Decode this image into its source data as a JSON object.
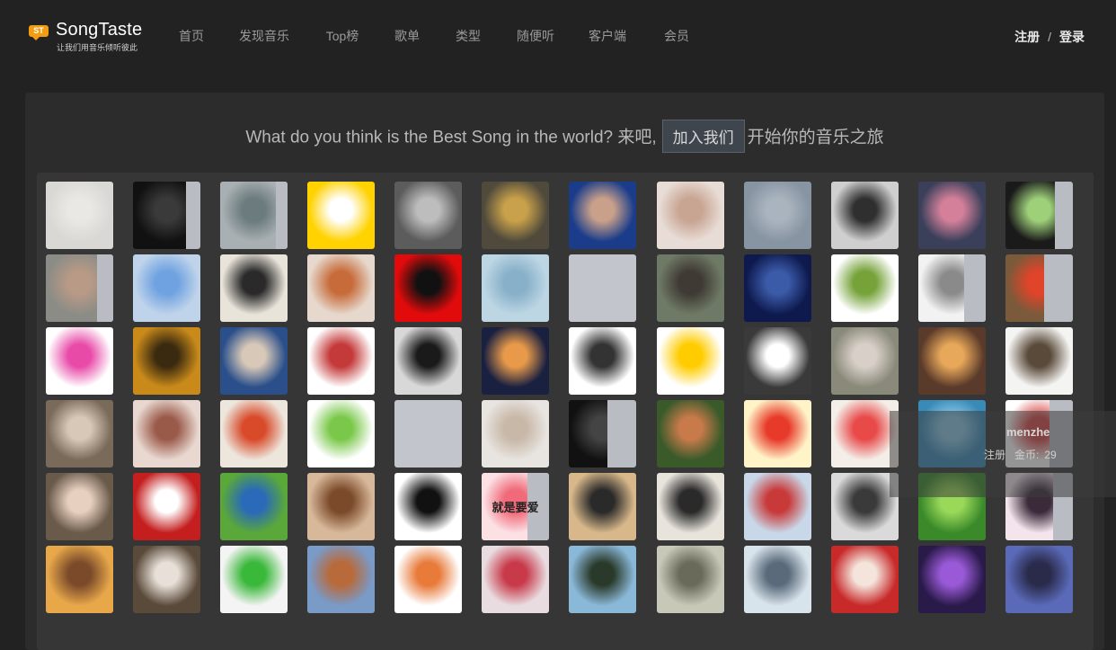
{
  "logo": {
    "badge": "ST",
    "name": "SongTaste",
    "slogan": "让我们用音乐倾听彼此"
  },
  "nav": [
    {
      "label": "首页",
      "active": true
    },
    {
      "label": "发现音乐",
      "active": false
    },
    {
      "label": "Top榜",
      "active": false
    },
    {
      "label": "歌单",
      "active": false
    },
    {
      "label": "类型",
      "active": false
    },
    {
      "label": "随便听",
      "active": false
    },
    {
      "label": "客户端",
      "active": false
    },
    {
      "label": "会员",
      "active": false
    }
  ],
  "auth": {
    "register": "注册",
    "separator": "/",
    "login": "登录"
  },
  "hero": {
    "text_before": "What do you think is the Best Song in the world? 来吧,",
    "join_button": "加入我们",
    "text_after": "开始你的音乐之旅"
  },
  "hover_card": {
    "name": "menzhe",
    "meta_a": "注册",
    "meta_b": "金币:",
    "meta_c": "29"
  },
  "avatars": [
    [
      {
        "c": "#d9d8d4",
        "c2": "#e9e8e4"
      },
      {
        "c": "#111111",
        "c2": "#3a3a3a",
        "strip": 16
      },
      {
        "c": "#a9b0b3",
        "c2": "#6b7b7e",
        "strip": 13
      },
      {
        "c": "#ffd200",
        "c2": "#ffffff"
      },
      {
        "c": "#5c5c5c",
        "c2": "#bdbdbd"
      },
      {
        "c": "#4f4a3c",
        "c2": "#c9a14a"
      },
      {
        "c": "#1a3c8a",
        "c2": "#c9a08a"
      },
      {
        "c": "#e8ddd6",
        "c2": "#c8a492"
      },
      {
        "c": "#8794a2",
        "c2": "#aab4bf"
      },
      {
        "c": "#cfcfcf",
        "c2": "#2f2f2f"
      },
      {
        "c": "#3a3f5a",
        "c2": "#d4809a"
      },
      {
        "c": "#1a1a1a",
        "c2": "#9ed07a",
        "strip": 20
      }
    ],
    [
      {
        "c": "#8c8c86",
        "c2": "#b89a86",
        "strip": 18
      },
      {
        "c": "#bfd3ea",
        "c2": "#6ea2e0"
      },
      {
        "c": "#e9e4da",
        "c2": "#2a2a2a"
      },
      {
        "c": "#e6d8cc",
        "c2": "#c76b3a"
      },
      {
        "c": "#e10b0b",
        "c2": "#111111"
      },
      {
        "c": "#bcd6e4",
        "c2": "#88b0c8"
      },
      {
        "c": "#c2c5cc",
        "c2": "#c2c5cc"
      },
      {
        "c": "#6f7a66",
        "c2": "#3f3a34"
      },
      {
        "c": "#0e1a4e",
        "c2": "#3b5aa8"
      },
      {
        "c": "#ffffff",
        "c2": "#76a23a"
      },
      {
        "c": "#f2f2f2",
        "c2": "#8a8a8a",
        "strip": 24
      },
      {
        "c": "#7a5a3a",
        "c2": "#e0442a",
        "strip": 32
      }
    ],
    [
      {
        "c": "#ffffff",
        "c2": "#e84aa8"
      },
      {
        "c": "#c98a1a",
        "c2": "#3a2a10"
      },
      {
        "c": "#2a4f8a",
        "c2": "#d8c8b8"
      },
      {
        "c": "#ffffff",
        "c2": "#c43a3a"
      },
      {
        "c": "#d8d8d8",
        "c2": "#1a1a1a"
      },
      {
        "c": "#1a2040",
        "c2": "#e89a4a"
      },
      {
        "c": "#ffffff",
        "c2": "#333333"
      },
      {
        "c": "#ffffff",
        "c2": "#ffcc00"
      },
      {
        "c": "#3a3a3a",
        "c2": "#ffffff"
      },
      {
        "c": "#8a8a7a",
        "c2": "#d8d0c8"
      },
      {
        "c": "#5a3a2a",
        "c2": "#e8a85a"
      },
      {
        "c": "#f4f4f2",
        "c2": "#5a4a3a"
      }
    ],
    [
      {
        "c": "#7a6a5a",
        "c2": "#d8c8b8"
      },
      {
        "c": "#e8d8d0",
        "c2": "#9a5a4a"
      },
      {
        "c": "#ede6dc",
        "c2": "#d84a2a"
      },
      {
        "c": "#ffffff",
        "c2": "#7ac84a"
      },
      {
        "c": "#c2c5cc",
        "c2": "#c2c5cc"
      },
      {
        "c": "#e8e4e0",
        "c2": "#c8b8a8"
      },
      {
        "c": "#111111",
        "c2": "#444444",
        "strip": 32
      },
      {
        "c": "#3a5a2a",
        "c2": "#c87a4a"
      },
      {
        "c": "#fff4c8",
        "c2": "#e83a2a"
      },
      {
        "c": "#f4eee8",
        "c2": "#e84a4a"
      },
      {
        "c": "#3a8ab8",
        "c2": "#8ac8e8"
      },
      {
        "c": "#ffffff",
        "c2": "#d84a4a",
        "strip": 26
      }
    ],
    [
      {
        "c": "#6a5a4a",
        "c2": "#e8d0c0"
      },
      {
        "c": "#c41e1e",
        "c2": "#ffffff"
      },
      {
        "c": "#5aa83a",
        "c2": "#2a6ab8"
      },
      {
        "c": "#d8b89a",
        "c2": "#7a4a2a"
      },
      {
        "c": "#ffffff",
        "c2": "#111111"
      },
      {
        "c": "#fce0e4",
        "c2": "#f06a7a",
        "strip": 24,
        "label": "就是要爱"
      },
      {
        "c": "#d8b88a",
        "c2": "#2a2a2a"
      },
      {
        "c": "#e8e4dc",
        "c2": "#2a2a2a"
      },
      {
        "c": "#c8d8e8",
        "c2": "#c83a3a"
      },
      {
        "c": "#dadada",
        "c2": "#3a3a3a"
      },
      {
        "c": "#3a8a2a",
        "c2": "#9ad85a"
      },
      {
        "c": "#f4e4ec",
        "c2": "#3a2a3a",
        "strip": 22
      }
    ],
    [
      {
        "c": "#e8a84a",
        "c2": "#7a4a2a"
      },
      {
        "c": "#5a4a3a",
        "c2": "#e8e0d8"
      },
      {
        "c": "#f4f4f4",
        "c2": "#3ab83a"
      },
      {
        "c": "#7a9ac8",
        "c2": "#b86a3a"
      },
      {
        "c": "#ffffff",
        "c2": "#e87a3a"
      },
      {
        "c": "#e8dce0",
        "c2": "#c83a4a"
      },
      {
        "c": "#8ab8d8",
        "c2": "#2a3a2a"
      },
      {
        "c": "#c8c8b8",
        "c2": "#6a6a5a"
      },
      {
        "c": "#d8e4ec",
        "c2": "#5a6a7a"
      },
      {
        "c": "#c82a2a",
        "c2": "#f4e4dc"
      },
      {
        "c": "#2a1a4a",
        "c2": "#9a5ad8"
      },
      {
        "c": "#5a6ab8",
        "c2": "#2a2a4a"
      }
    ]
  ]
}
